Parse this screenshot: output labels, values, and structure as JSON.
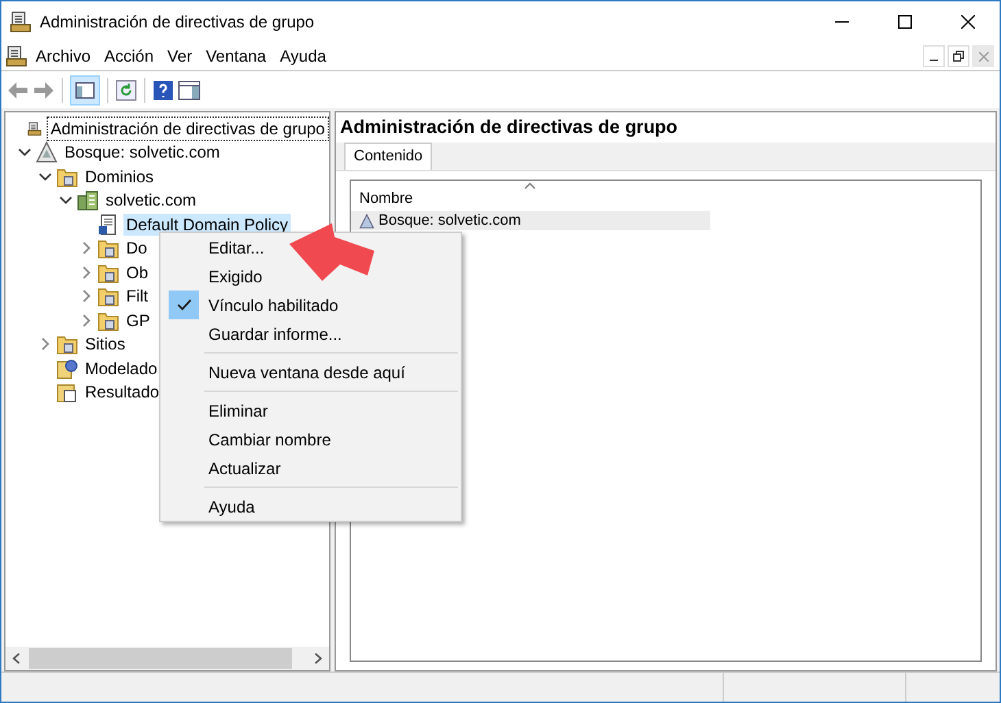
{
  "window": {
    "title": "Administración de directivas de grupo"
  },
  "menu_bar": [
    "Archivo",
    "Acción",
    "Ver",
    "Ventana",
    "Ayuda"
  ],
  "tree": [
    {
      "label": "Administración de directivas de grupo",
      "kind": "root",
      "selected": false,
      "children": [
        {
          "label": "Bosque: solvetic.com",
          "kind": "forest",
          "expanded": true,
          "selected": false,
          "children": [
            {
              "label": "Dominios",
              "kind": "domains",
              "expanded": true,
              "selected": false,
              "children": [
                {
                  "label": "solvetic.com",
                  "kind": "domain",
                  "expanded": true,
                  "selected": false,
                  "children": [
                    {
                      "label": "Default Domain Policy",
                      "kind": "gpo",
                      "selected": true
                    },
                    {
                      "label": "Do",
                      "kind": "folder",
                      "expanded": false,
                      "selected": false
                    },
                    {
                      "label": "Ob",
                      "kind": "folder",
                      "expanded": false,
                      "selected": false
                    },
                    {
                      "label": "Filt",
                      "kind": "folder",
                      "expanded": false,
                      "selected": false
                    },
                    {
                      "label": "GP",
                      "kind": "folder",
                      "expanded": false,
                      "selected": false
                    }
                  ]
                }
              ]
            },
            {
              "label": "Sitios",
              "kind": "folder",
              "expanded": false,
              "selected": false
            },
            {
              "label": "Modelado",
              "kind": "modeling",
              "selected": false
            },
            {
              "label": "Resultado",
              "kind": "results",
              "selected": false
            }
          ]
        }
      ]
    }
  ],
  "content": {
    "title": "Administración de directivas de grupo",
    "tabs": [
      {
        "label": "Contenido",
        "selected": true
      }
    ],
    "columns": [
      "Nombre"
    ],
    "rows": [
      {
        "name": "Bosque: solvetic.com",
        "selected": true
      }
    ]
  },
  "context_menu": [
    {
      "kind": "item",
      "label": "Editar...",
      "checked": false
    },
    {
      "kind": "item",
      "label": "Exigido",
      "checked": false
    },
    {
      "kind": "item",
      "label": "Vínculo habilitado",
      "checked": true
    },
    {
      "kind": "item",
      "label": "Guardar informe...",
      "checked": false
    },
    {
      "kind": "separator"
    },
    {
      "kind": "item",
      "label": "Nueva ventana desde aquí",
      "checked": false
    },
    {
      "kind": "separator"
    },
    {
      "kind": "item",
      "label": "Eliminar",
      "checked": false
    },
    {
      "kind": "item",
      "label": "Cambiar nombre",
      "checked": false
    },
    {
      "kind": "item",
      "label": "Actualizar",
      "checked": false
    },
    {
      "kind": "separator"
    },
    {
      "kind": "item",
      "label": "Ayuda",
      "checked": false
    }
  ]
}
